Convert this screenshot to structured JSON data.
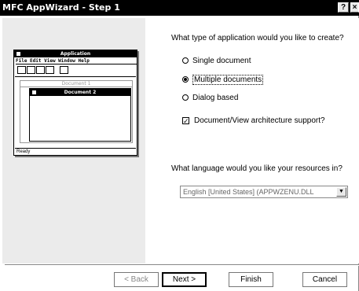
{
  "window": {
    "title": "MFC AppWizard - Step 1",
    "help_glyph": "?",
    "close_glyph": "×"
  },
  "preview": {
    "app_title": "Application",
    "menu_bar": "File  Edit  View  Window  Help",
    "doc1_title": "Document 1",
    "doc2_title": "Document 2",
    "status": "Ready"
  },
  "app_type": {
    "question": "What type of application would you like to create?",
    "options": [
      {
        "label": "Single document",
        "checked": false
      },
      {
        "label": "Multiple documents",
        "checked": true
      },
      {
        "label": "Dialog based",
        "checked": false
      }
    ],
    "docview_label": "Document/View architecture support?",
    "docview_checked": true,
    "docview_mark": "✓"
  },
  "language": {
    "question": "What language would you like your resources in?",
    "selected": "English [United States] (APPWZENU.DLL",
    "arrow_glyph": "▼"
  },
  "buttons": {
    "back": "< Back",
    "next": "Next >",
    "finish": "Finish",
    "cancel": "Cancel"
  }
}
